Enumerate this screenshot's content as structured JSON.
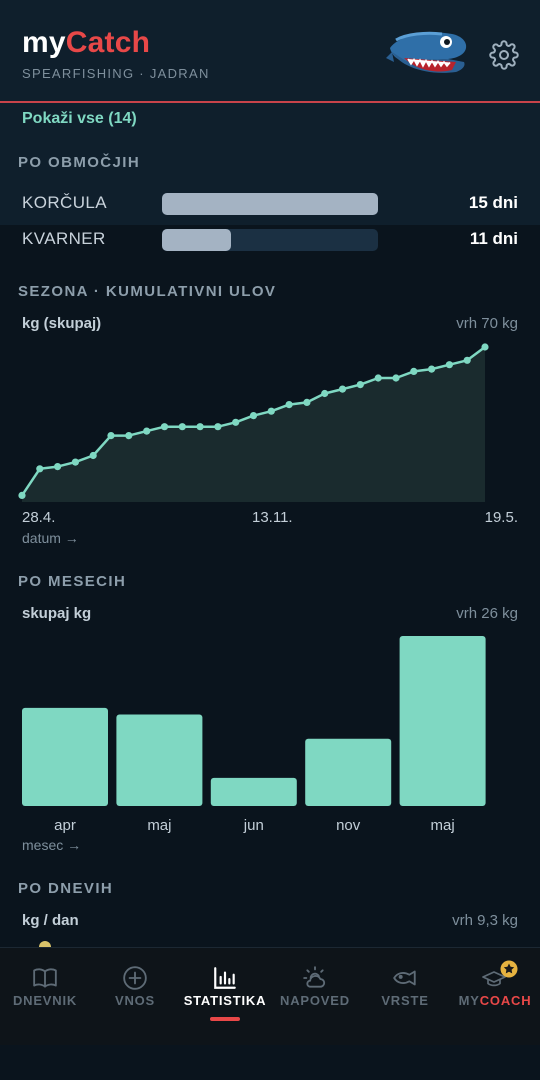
{
  "app": {
    "title_my": "my",
    "title_catch": "Catch",
    "subtitle": "SPEARFISHING · JADRAN",
    "brand_red": "#e84848",
    "accent_teal": "#7fd8c2"
  },
  "regions": {
    "show_all": "Pokaži vse (14)",
    "title": "PO OBMOČJIH",
    "items": [
      {
        "name": "KORČULA",
        "value": "15 dni",
        "fraction": 1.0
      },
      {
        "name": "KVARNER",
        "value": "11 dni",
        "fraction": 0.32
      }
    ]
  },
  "season": {
    "title": "SEZONA · KUMULATIVNI ULOV",
    "ylabel": "kg (skupaj)",
    "peak": "vrh 70 kg",
    "x_ticks": [
      "28.4.",
      "13.11.",
      "19.5."
    ],
    "xlabel": "datum →"
  },
  "monthly": {
    "title": "PO MESECIH",
    "ylabel": "skupaj kg",
    "peak": "vrh 26 kg",
    "xlabel": "mesec →"
  },
  "daily": {
    "title": "PO DNEVIH",
    "ylabel": "kg / dan",
    "peak": "vrh 9,3 kg"
  },
  "nav": {
    "items": [
      {
        "label": "DNEVNIK",
        "icon": "book-icon"
      },
      {
        "label": "VNOS",
        "icon": "plus-circle-icon"
      },
      {
        "label": "STATISTIKA",
        "icon": "bar-chart-icon"
      },
      {
        "label": "NAPOVED",
        "icon": "weather-icon"
      },
      {
        "label": "VRSTE",
        "icon": "fish-icon"
      }
    ],
    "coach_prefix": "MY",
    "coach_suffix": "COACH",
    "active": "STATISTIKA"
  },
  "chart_data": [
    {
      "type": "area",
      "title": "SEZONA · KUMULATIVNI ULOV",
      "ylabel": "kg (skupaj)",
      "xlabel": "datum →",
      "x_ticks": [
        "28.4.",
        "13.11.",
        "19.5."
      ],
      "ylim": [
        0,
        70
      ],
      "values": [
        3,
        15,
        16,
        18,
        21,
        30,
        30,
        32,
        34,
        34,
        34,
        34,
        36,
        39,
        41,
        44,
        45,
        49,
        51,
        53,
        56,
        56,
        59,
        60,
        62,
        64,
        70
      ]
    },
    {
      "type": "bar",
      "title": "PO MESECIH",
      "ylabel": "skupaj kg",
      "xlabel": "mesec →",
      "ylim": [
        0,
        26
      ],
      "categories": [
        "apr",
        "maj",
        "jun",
        "nov",
        "maj"
      ],
      "values": [
        15,
        14,
        4.3,
        10.3,
        26
      ]
    }
  ]
}
